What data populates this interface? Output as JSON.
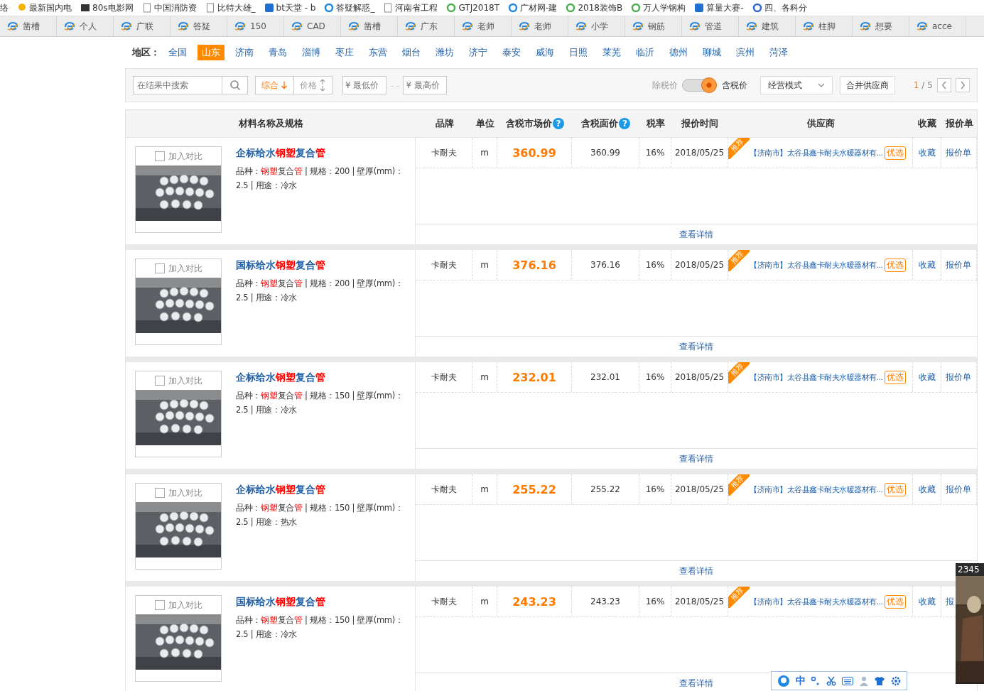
{
  "bookmarks": [
    {
      "label": "络",
      "kind": "plain"
    },
    {
      "label": "最新国内电",
      "kind": "bulb"
    },
    {
      "label": "80s电影网",
      "kind": "film"
    },
    {
      "label": "中国消防资",
      "kind": "page"
    },
    {
      "label": "比特大雄_",
      "kind": "page"
    },
    {
      "label": "bt天堂 - b",
      "kind": "square"
    },
    {
      "label": "答疑解惑_",
      "kind": "ring"
    },
    {
      "label": "河南省工程",
      "kind": "page"
    },
    {
      "label": "GTJ2018T",
      "kind": "leaf"
    },
    {
      "label": "广材网-建",
      "kind": "ring"
    },
    {
      "label": "2018装饰B",
      "kind": "leaf"
    },
    {
      "label": "万人学钢构",
      "kind": "leaf"
    },
    {
      "label": "算量大赛-",
      "kind": "square"
    },
    {
      "label": "四、各科分",
      "kind": "cloud"
    }
  ],
  "tabs": [
    {
      "label": "凿槽"
    },
    {
      "label": "个人"
    },
    {
      "label": "广联"
    },
    {
      "label": "答疑"
    },
    {
      "label": "150"
    },
    {
      "label": "CAD"
    },
    {
      "label": "凿槽"
    },
    {
      "label": "广东"
    },
    {
      "label": "老师"
    },
    {
      "label": "老师"
    },
    {
      "label": "小学"
    },
    {
      "label": "钢筋"
    },
    {
      "label": "管道"
    },
    {
      "label": "建筑"
    },
    {
      "label": "柱脚"
    },
    {
      "label": "想要"
    },
    {
      "label": "acce"
    }
  ],
  "region": {
    "label": "地区：",
    "items": [
      {
        "label": "全国",
        "selected": false
      },
      {
        "label": "山东",
        "selected": true
      },
      {
        "label": "济南",
        "selected": false
      },
      {
        "label": "青岛",
        "selected": false
      },
      {
        "label": "淄博",
        "selected": false
      },
      {
        "label": "枣庄",
        "selected": false
      },
      {
        "label": "东营",
        "selected": false
      },
      {
        "label": "烟台",
        "selected": false
      },
      {
        "label": "潍坊",
        "selected": false
      },
      {
        "label": "济宁",
        "selected": false
      },
      {
        "label": "泰安",
        "selected": false
      },
      {
        "label": "威海",
        "selected": false
      },
      {
        "label": "日照",
        "selected": false
      },
      {
        "label": "莱芜",
        "selected": false
      },
      {
        "label": "临沂",
        "selected": false
      },
      {
        "label": "德州",
        "selected": false
      },
      {
        "label": "聊城",
        "selected": false
      },
      {
        "label": "滨州",
        "selected": false
      },
      {
        "label": "菏泽",
        "selected": false
      }
    ]
  },
  "filter": {
    "search_placeholder": "在结果中搜索",
    "sorts": [
      {
        "label": "综合",
        "selected": true
      },
      {
        "label": "价格",
        "selected": false
      }
    ],
    "min_placeholder": "¥ 最低价",
    "separator": "- -",
    "max_placeholder": "¥ 最高价",
    "toggle_off_label": "除税价",
    "toggle_on": true,
    "toggle_on_label": "含税价",
    "mode": "经营模式",
    "merge": "合并供应商",
    "page_current": "1",
    "page_sep": "/",
    "page_total": "5"
  },
  "columns": [
    {
      "label": "材料名称及规格"
    },
    {
      "label": "品牌"
    },
    {
      "label": "单位"
    },
    {
      "label": "含税市场价",
      "help_icon": "?"
    },
    {
      "label": "含税面价",
      "help_icon": "?"
    },
    {
      "label": "税率"
    },
    {
      "label": "报价时间"
    },
    {
      "label": "供应商"
    },
    {
      "label": "收藏"
    },
    {
      "label": "报价单"
    }
  ],
  "rows": [
    {
      "compare": "加入对比",
      "checked": false,
      "title": "企标给水**钢塑**复合**管**",
      "spec": "品种：**钢塑**复合**管** | 规格：200 | 壁厚(mm)：2.5 | 用途：冷水",
      "brand": "卡耐夫",
      "unit": "m",
      "price": "360.99",
      "face": "360.99",
      "tax": "16%",
      "date": "2018/05/25",
      "badge": "推荐",
      "supplier": "【济南市】太谷县鑫卡耐夫水暖器材有...",
      "tag": "优选",
      "fav": "收藏",
      "quote": "报价单",
      "detail": "查看详情"
    },
    {
      "compare": "加入对比",
      "checked": false,
      "title": "国标给水**钢塑**复合**管**",
      "spec": "品种：**钢塑**复合**管** | 规格：200 | 壁厚(mm)：2.5 | 用途：冷水",
      "brand": "卡耐夫",
      "unit": "m",
      "price": "376.16",
      "face": "376.16",
      "tax": "16%",
      "date": "2018/05/25",
      "badge": "推荐",
      "supplier": "【济南市】太谷县鑫卡耐夫水暖器材有...",
      "tag": "优选",
      "fav": "收藏",
      "quote": "报价单",
      "detail": "查看详情"
    },
    {
      "compare": "加入对比",
      "checked": false,
      "title": "企标给水**钢塑**复合**管**",
      "spec": "品种：**钢塑**复合**管** | 规格：150 | 壁厚(mm)：2.5 | 用途：冷水",
      "brand": "卡耐夫",
      "unit": "m",
      "price": "232.01",
      "face": "232.01",
      "tax": "16%",
      "date": "2018/05/25",
      "badge": "推荐",
      "supplier": "【济南市】太谷县鑫卡耐夫水暖器材有...",
      "tag": "优选",
      "fav": "收藏",
      "quote": "报价单",
      "detail": "查看详情"
    },
    {
      "compare": "加入对比",
      "checked": false,
      "title": "企标给水**钢塑**复合**管**",
      "spec": "品种：**钢塑**复合**管** | 规格：150 | 壁厚(mm)：2.5 | 用途：热水",
      "brand": "卡耐夫",
      "unit": "m",
      "price": "255.22",
      "face": "255.22",
      "tax": "16%",
      "date": "2018/05/25",
      "badge": "推荐",
      "supplier": "【济南市】太谷县鑫卡耐夫水暖器材有...",
      "tag": "优选",
      "fav": "收藏",
      "quote": "报价单",
      "detail": "查看详情"
    },
    {
      "compare": "加入对比",
      "checked": false,
      "title": "国标给水**钢塑**复合**管**",
      "spec": "品种：**钢塑**复合**管** | 规格：150 | 壁厚(mm)：2.5 | 用途：冷水",
      "brand": "卡耐夫",
      "unit": "m",
      "price": "243.23",
      "face": "243.23",
      "tax": "16%",
      "date": "2018/05/25",
      "badge": "推荐",
      "supplier": "【济南市】太谷县鑫卡耐夫水暖器材有...",
      "tag": "优选",
      "fav": "收藏",
      "quote": "报",
      "detail": "查看详情"
    }
  ],
  "popup": {
    "title": "2345",
    "kind": "picture"
  },
  "ime": {
    "lang": "中"
  }
}
